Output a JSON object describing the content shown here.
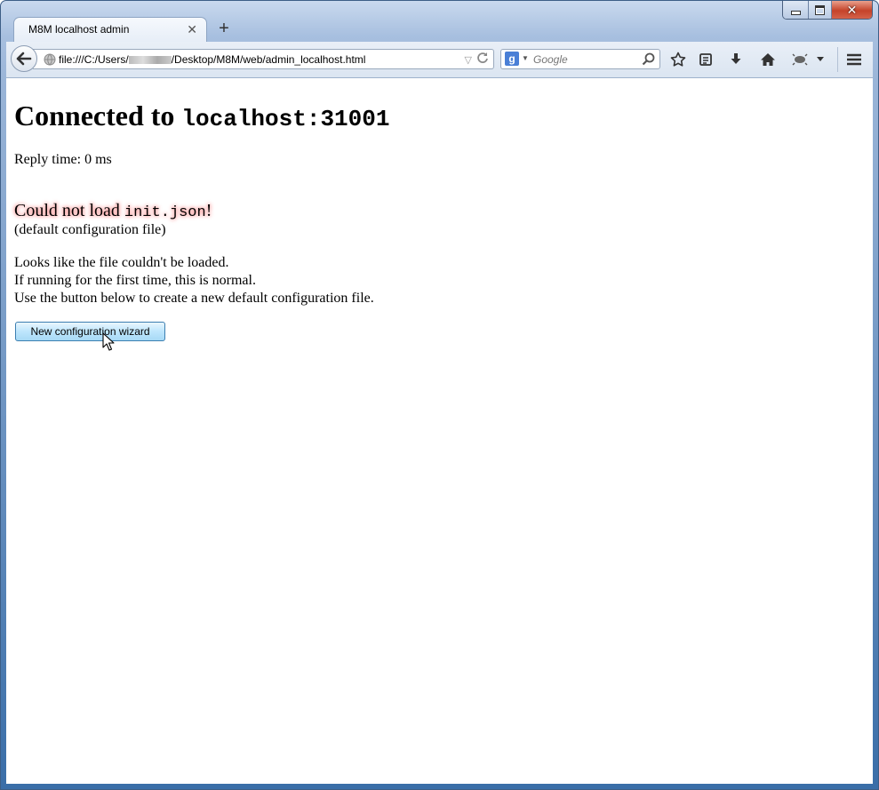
{
  "window": {
    "controls": {
      "minimize": "minimize",
      "maximize": "maximize",
      "close": "close"
    }
  },
  "tab": {
    "title": "M8M localhost admin",
    "close_glyph": "✕",
    "new_tab_glyph": "+"
  },
  "toolbar": {
    "url_prefix": "file:///C:/Users/",
    "url_suffix": "/Desktop/M8M/web/admin_localhost.html",
    "search_placeholder": "Google",
    "search_engine_letter": "g",
    "icons": [
      "back-icon",
      "globe-icon",
      "reload-icon",
      "search-icon",
      "star-icon",
      "reading-list-icon",
      "download-icon",
      "home-icon",
      "addon-icon",
      "menu-icon"
    ]
  },
  "page": {
    "heading_prefix": "Connected to ",
    "heading_host": "localhost:31001",
    "reply_time": "Reply time: 0 ms",
    "error_prefix": "Could not load ",
    "error_file": "init.json",
    "error_suffix": "!",
    "error_sub": "(default configuration file)",
    "explain_line1": "Looks like the file couldn't be loaded.",
    "explain_line2": "If running for the first time, this is normal.",
    "explain_line3": "Use the button below to create a new default configuration file.",
    "wizard_button": "New configuration wizard"
  },
  "colors": {
    "button_border": "#3c7fb1",
    "error_glow": "#ff8080",
    "frame": "#9ab5d8"
  }
}
